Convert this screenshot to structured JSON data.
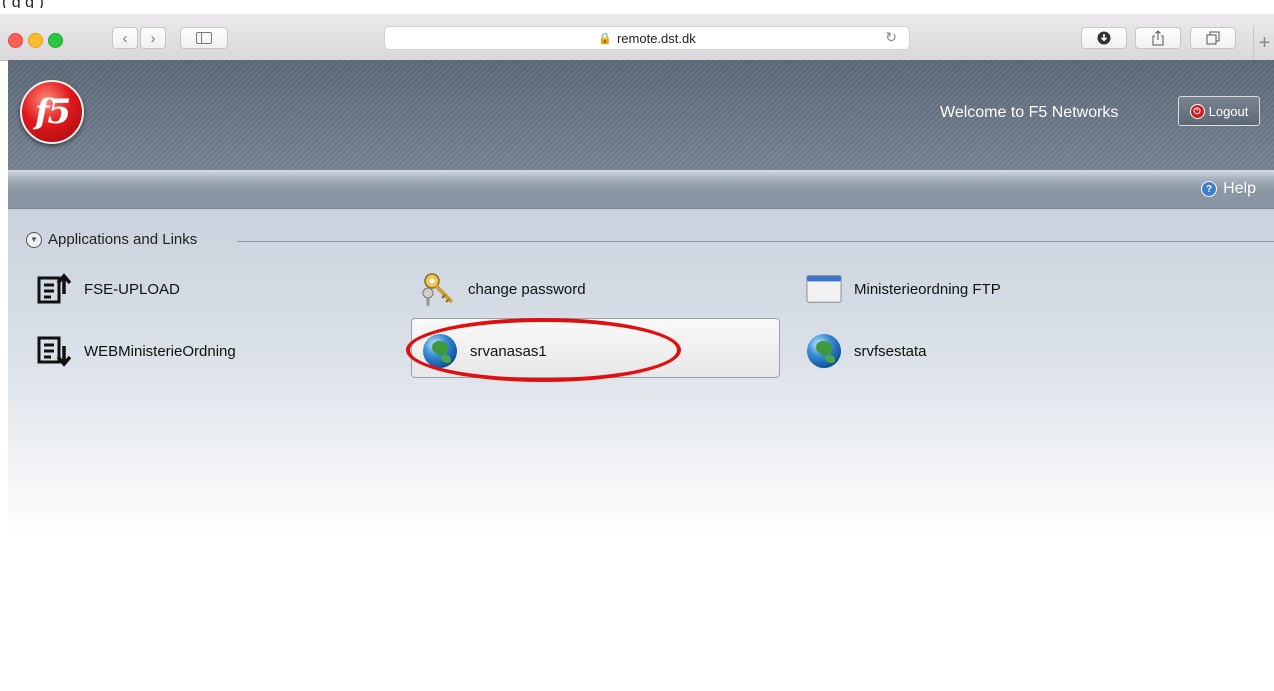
{
  "browser": {
    "url": "remote.dst.dk",
    "doc_fragment": "(                                                                                           g                    g     )"
  },
  "header": {
    "logo_text": "f5",
    "welcome": "Welcome to F5 Networks",
    "logout_label": "Logout"
  },
  "helpbar": {
    "help_label": "Help"
  },
  "section": {
    "title": "Applications and Links"
  },
  "apps": [
    {
      "label": "FSE-UPLOAD",
      "icon": "upload-doc-icon"
    },
    {
      "label": "change password",
      "icon": "key-icon"
    },
    {
      "label": "Ministerieordning FTP",
      "icon": "window-icon"
    },
    {
      "label": "WEBMinisterieOrdning",
      "icon": "download-doc-icon"
    },
    {
      "label": "srvanasas1",
      "icon": "globe-icon"
    },
    {
      "label": "srvfsestata",
      "icon": "globe-icon"
    }
  ]
}
